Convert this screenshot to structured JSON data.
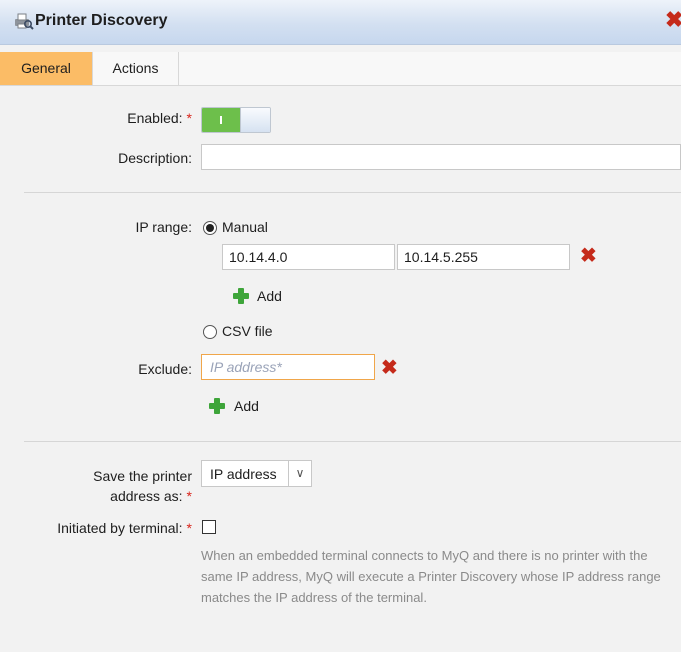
{
  "window": {
    "title": "Printer Discovery",
    "icon": "printer-search-icon",
    "close_icon": "close-icon"
  },
  "tabs": [
    {
      "label": "General",
      "active": true
    },
    {
      "label": "Actions",
      "active": false
    }
  ],
  "form": {
    "enabled": {
      "label": "Enabled:",
      "required": "*",
      "value": true
    },
    "description": {
      "label": "Description:",
      "value": ""
    },
    "ip_range": {
      "label": "IP range:",
      "manual_label": "Manual",
      "selected": "Manual",
      "from": "10.14.4.0",
      "to": "10.14.5.255",
      "add_label": "Add",
      "csv_label": "CSV file"
    },
    "exclude": {
      "label": "Exclude:",
      "placeholder": "IP address*",
      "value": "",
      "add_label": "Add"
    },
    "save_address": {
      "label_line1": "Save the printer",
      "label_line2": "address as:",
      "required": "*",
      "value": "IP address"
    },
    "initiated_by_terminal": {
      "label": "Initiated by terminal:",
      "required": "*",
      "checked": false,
      "help_text": "When an embedded terminal connects to MyQ and there is no printer with the same IP address, MyQ will execute a Printer Discovery whose IP address range matches the IP address of the terminal."
    }
  },
  "colors": {
    "active_tab": "#fbbc66",
    "toggle_on": "#6dbf4b",
    "delete": "#c52a1a",
    "add": "#3ea53a",
    "required": "#d9231a",
    "focus_border": "#f0a64a"
  }
}
